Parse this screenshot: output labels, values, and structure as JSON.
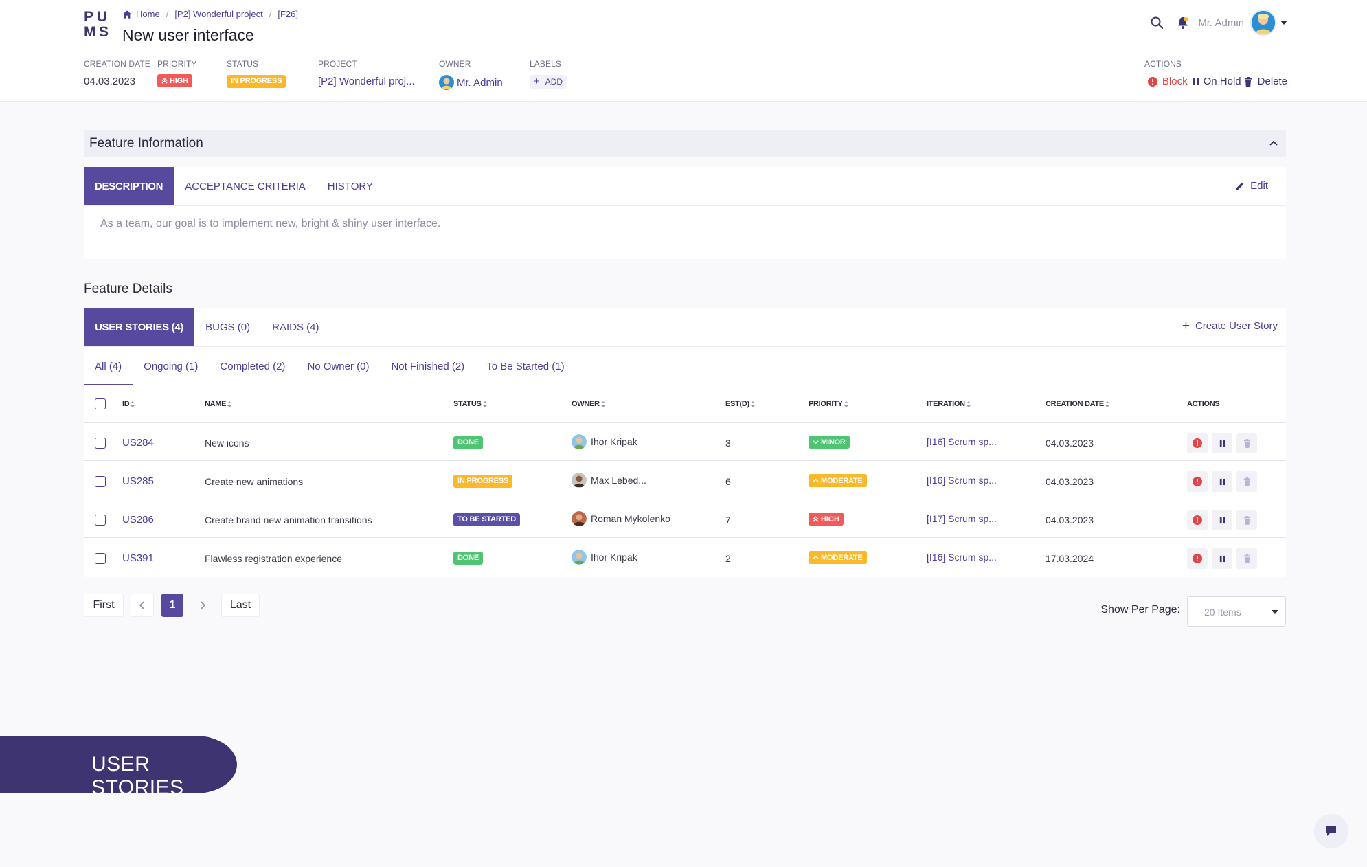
{
  "header": {
    "logo_text": "PUMS",
    "breadcrumb": [
      "Home",
      "[P2] Wonderful project",
      "[F26]"
    ],
    "title": "New user interface",
    "user_name": "Mr. Admin"
  },
  "meta": {
    "creation_date": {
      "label": "CREATION DATE",
      "value": "04.03.2023"
    },
    "priority": {
      "label": "PRIORITY",
      "value": "HIGH"
    },
    "status": {
      "label": "STATUS",
      "value": "IN PROGRESS"
    },
    "project": {
      "label": "PROJECT",
      "value": "[P2] Wonderful proj..."
    },
    "owner": {
      "label": "OWNER",
      "value": "Mr. Admin"
    },
    "labels": {
      "label": "LABELS",
      "add": "ADD"
    },
    "actions": {
      "label": "ACTIONS",
      "block": "Block",
      "on_hold": "On Hold",
      "delete": "Delete"
    }
  },
  "feature_info": {
    "title": "Feature Information",
    "tabs": [
      "DESCRIPTION",
      "ACCEPTANCE CRITERIA",
      "HISTORY"
    ],
    "edit": "Edit",
    "description": "As a team, our goal is to implement new, bright & shiny user interface."
  },
  "feature_details": {
    "title": "Feature Details",
    "tabs": [
      "USER STORIES (4)",
      "BUGS (0)",
      "RAIDS (4)"
    ],
    "create": "Create User Story",
    "filters": [
      "All (4)",
      "Ongoing (1)",
      "Completed (2)",
      "No Owner (0)",
      "Not Finished (2)",
      "To Be Started (1)"
    ],
    "columns": [
      "ID",
      "NAME",
      "STATUS",
      "OWNER",
      "EST(D)",
      "PRIORITY",
      "ITERATION",
      "CREATION DATE",
      "ACTIONS"
    ],
    "rows": [
      {
        "id": "US284",
        "name": "New icons",
        "status": "DONE",
        "owner": "Ihor Kripak",
        "est": "3",
        "priority": "MINOR",
        "iteration": "[I16] Scrum sp...",
        "date": "04.03.2023"
      },
      {
        "id": "US285",
        "name": "Create new animations",
        "status": "IN PROGRESS",
        "owner": "Max Lebed...",
        "est": "6",
        "priority": "MODERATE",
        "iteration": "[I16] Scrum sp...",
        "date": "04.03.2023"
      },
      {
        "id": "US286",
        "name": "Create brand new animation transitions",
        "status": "TO BE STARTED",
        "owner": "Roman Mykolenko",
        "est": "7",
        "priority": "HIGH",
        "iteration": "[I17] Scrum sp...",
        "date": "04.03.2023"
      },
      {
        "id": "US391",
        "name": "Flawless registration experience",
        "status": "DONE",
        "owner": "Ihor Kripak",
        "est": "2",
        "priority": "MODERATE",
        "iteration": "[I16] Scrum sp...",
        "date": "17.03.2024"
      }
    ]
  },
  "pagination": {
    "first": "First",
    "last": "Last",
    "current": "1",
    "per_page_label": "Show Per Page:",
    "per_page_value": "20 Items"
  },
  "banner": "USER STORIES",
  "colors": {
    "accent": "#574a9e",
    "link": "#4a3e9a",
    "high": "#f25a5a",
    "progress": "#fbb829",
    "done": "#4fc472"
  }
}
